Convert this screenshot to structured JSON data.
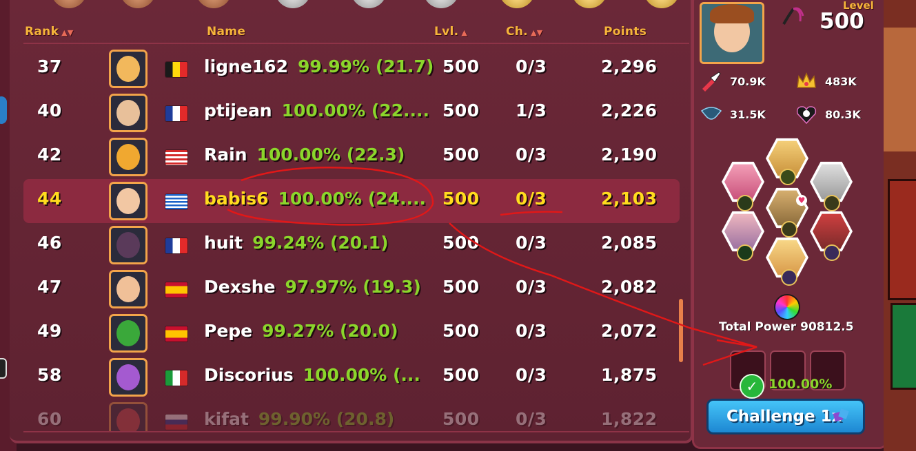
{
  "header": {
    "rank": "Rank",
    "name": "Name",
    "lvl": "Lvl.",
    "ch": "Ch.",
    "points": "Points"
  },
  "sort_icons": {
    "rank": "up-down-arrows-icon",
    "lvl": "up-arrow-icon",
    "ch": "up-down-arrows-icon"
  },
  "rows": [
    {
      "rank": "37",
      "name": "ligne162",
      "stat": "99.99% (21.7)",
      "lvl": "500",
      "ch": "0/3",
      "points": "2,296",
      "flag": "belgium",
      "avatar_color": "#f2b85c"
    },
    {
      "rank": "40",
      "name": "ptijean",
      "stat": "100.00% (22....",
      "lvl": "500",
      "ch": "1/3",
      "points": "2,226",
      "flag": "france",
      "avatar_color": "#e8c09a"
    },
    {
      "rank": "42",
      "name": "Rain",
      "stat": "100.00% (22.3)",
      "lvl": "500",
      "ch": "0/3",
      "points": "2,190",
      "flag": "malaysia",
      "avatar_color": "#f0a830"
    },
    {
      "rank": "44",
      "name": "babis6",
      "stat": "100.00% (24....",
      "lvl": "500",
      "ch": "0/3",
      "points": "2,103",
      "flag": "greece",
      "avatar_color": "#f2c7a3",
      "highlight": true
    },
    {
      "rank": "46",
      "name": "huit",
      "stat": "99.24% (20.1)",
      "lvl": "500",
      "ch": "0/3",
      "points": "2,085",
      "flag": "france",
      "avatar_color": "#5a3a5a"
    },
    {
      "rank": "47",
      "name": "Dexshe",
      "stat": "97.97% (19.3)",
      "lvl": "500",
      "ch": "0/3",
      "points": "2,082",
      "flag": "spain",
      "avatar_color": "#f0c098"
    },
    {
      "rank": "49",
      "name": "Pepe",
      "stat": "99.27% (20.0)",
      "lvl": "500",
      "ch": "0/3",
      "points": "2,072",
      "flag": "spain",
      "avatar_color": "#3aa83a"
    },
    {
      "rank": "58",
      "name": "Discorius",
      "stat": "100.00% (...",
      "lvl": "500",
      "ch": "0/3",
      "points": "1,875",
      "flag": "italy",
      "avatar_color": "#a45ad0"
    },
    {
      "rank": "60",
      "name": "kifat",
      "stat": "99.90% (20.8)",
      "lvl": "500",
      "ch": "0/3",
      "points": "1,822",
      "flag": "russia",
      "avatar_color": "#c84a4a",
      "faded": true
    }
  ],
  "side": {
    "level_label": "Level",
    "level_value": "500",
    "stats": [
      {
        "icon": "attack-icon",
        "value": "70.9K"
      },
      {
        "icon": "crown-icon",
        "value": "483K"
      },
      {
        "icon": "defense-icon",
        "value": "31.5K"
      },
      {
        "icon": "harmony-icon",
        "value": "80.3K"
      }
    ],
    "total_power_label": "Total Power",
    "total_power_value": "90812.5",
    "win_chance": "100.00%",
    "challenge_label": "Challenge 1x"
  },
  "colors": {
    "panel": "#6b2838",
    "header_text": "#f6b53a",
    "stat_green": "#8bd62b",
    "highlight_text": "#ffdc1e",
    "annotation_red": "#e01818",
    "button_blue": "#2fa6ea"
  }
}
